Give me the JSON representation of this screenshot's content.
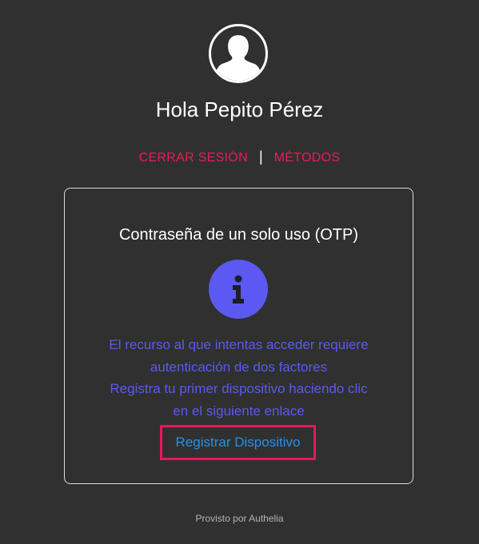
{
  "user": {
    "greeting": "Hola Pepito Pérez",
    "avatar_icon": "user-silhouette-icon"
  },
  "nav": {
    "logout_label": "CERRAR SESIÓN",
    "separator": "|",
    "methods_label": "MÉTODOS"
  },
  "card": {
    "title": "Contraseña de un solo uso (OTP)",
    "icon": "info-icon",
    "message_lines": [
      "El recurso al que intentas acceder requiere",
      "autenticación de dos factores",
      "Registra tu primer dispositivo haciendo clic",
      "en el siguiente enlace"
    ],
    "register_link_label": "Registrar Dispositivo"
  },
  "footer": {
    "text": "Provisto por Authelia"
  },
  "colors": {
    "background": "#303030",
    "accent": "#ea1d57",
    "info": "#5b59f1",
    "link": "#2f8fe0",
    "highlight_border": "#e8175d"
  }
}
